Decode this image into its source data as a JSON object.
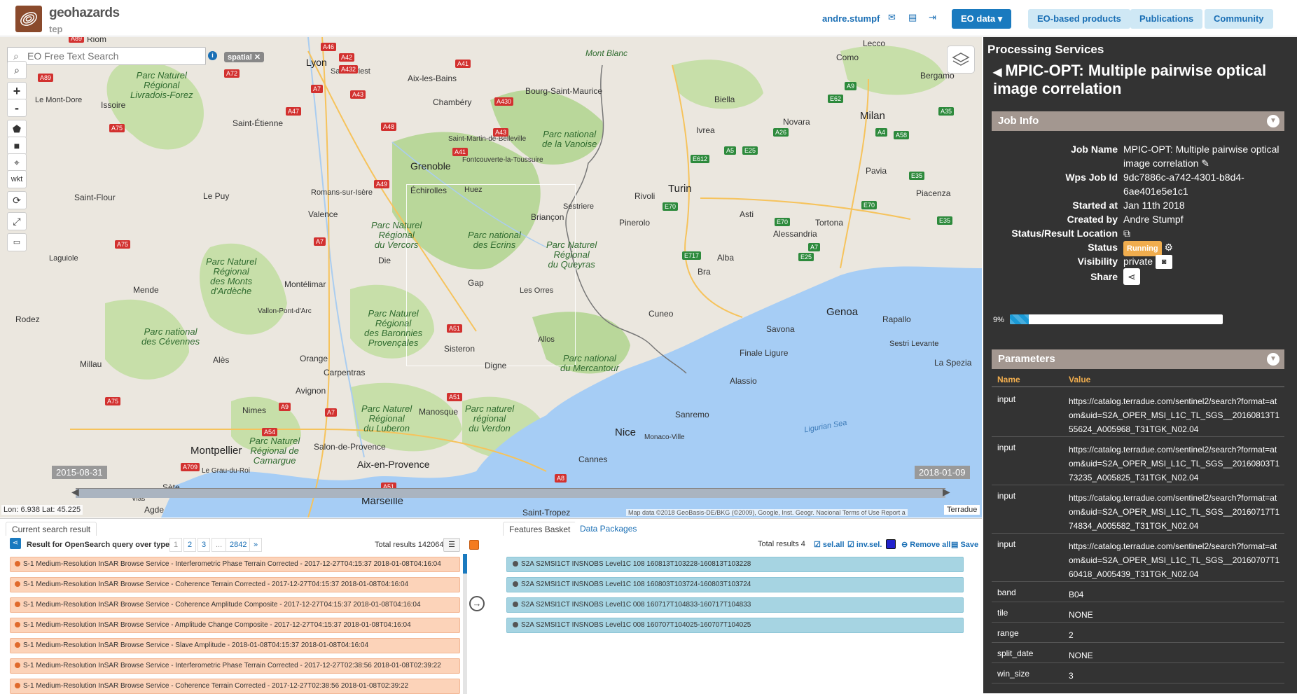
{
  "header": {
    "logo_name": "geohazards",
    "logo_sub": "tep",
    "username": "andre.stumpf",
    "nav": {
      "eo_data": "EO data ▾",
      "eo_products": "EO-based products",
      "publications": "Publications",
      "community": "Community"
    }
  },
  "map": {
    "search_placeholder": "EO Free Text Search",
    "spatial_tag": "spatial ✕",
    "wkt_label": "wkt",
    "date_start": "2015-08-31",
    "date_end": "2018-01-09",
    "coords": "Lon: 6.938 Lat: 45.225",
    "attribution": "Map data ©2018 GeoBasis-DE/BKG (©2009), Google, Inst. Geogr. Nacional   Terms of Use   Report a",
    "terradue": "Terradue",
    "labels": {
      "riom": "Riom",
      "lyon": "Lyon",
      "mont_blanc": "Mont Blanc",
      "lecco": "Lecco",
      "como": "Como",
      "issoire": "Issoire",
      "le_mont_dore": "Le Mont-Dore",
      "aix_les_bains": "Aix-les-Bains",
      "chambery": "Chambéry",
      "bourg": "Bourg-Saint-Maurice",
      "biella": "Biella",
      "bergamo": "Bergamo",
      "milan": "Milan",
      "novara": "Novara",
      "ivrea": "Ivrea",
      "st_etienne": "Saint-Étienne",
      "saint_priest": "Saint-Priest",
      "st_martin": "Saint-Martin-de-Belleville",
      "fontcouverte": "Fontcouverte-la-Toussuire",
      "grenoble": "Grenoble",
      "echirolles": "Échirolles",
      "huez": "Huez",
      "briancon": "Briançon",
      "sestriere": "Sestriere",
      "rivoli": "Rivoli",
      "turin": "Turin",
      "asti": "Asti",
      "pavia": "Pavia",
      "piacenza": "Piacenza",
      "le_puy": "Le Puy",
      "saint_flour": "Saint-Flour",
      "romans": "Romans-sur-Isère",
      "valence": "Valence",
      "pinerolo": "Pinerolo",
      "alessandria": "Alessandria",
      "tortona": "Tortona",
      "laguiole": "Laguiole",
      "die": "Die",
      "gap": "Gap",
      "les_orres": "Les Orres",
      "bra": "Bra",
      "alba": "Alba",
      "mende": "Mende",
      "montelimar": "Montélimar",
      "vallon": "Vallon-Pont-d'Arc",
      "cuneo": "Cuneo",
      "genoa": "Genoa",
      "rapallo": "Rapallo",
      "rodez": "Rodez",
      "savona": "Savona",
      "sestri": "Sestri Levante",
      "la_spezia": "La Spezia",
      "finale": "Finale Ligure",
      "sisteron": "Sisteron",
      "allos": "Allos",
      "millau": "Millau",
      "ales": "Alès",
      "orange": "Orange",
      "carpentras": "Carpentras",
      "digne": "Digne",
      "alassio": "Alassio",
      "avignon": "Avignon",
      "nimes": "Nimes",
      "manosque": "Manosque",
      "sanremo": "Sanremo",
      "nice": "Nice",
      "monaco": "Monaco-Ville",
      "montpellier": "Montpellier",
      "salon": "Salon-de-Provence",
      "aix": "Aix-en-Provence",
      "cannes": "Cannes",
      "le_grau": "Le Grau-du-Roi",
      "sete": "Sète",
      "marseille": "Marseille",
      "saint_tropez": "Saint-Tropez",
      "agde": "Agde",
      "vias": "Vias",
      "ligurian_sea": "Ligurian Sea",
      "park_livradois": "Parc Naturel\nRégional\nLivradois-Forez",
      "park_vanoise": "Parc national\nde la Vanoise",
      "park_vercors": "Parc Naturel\nRégional\ndu Vercors",
      "park_ecrins": "Parc national\ndes Ecrins",
      "park_queyras": "Parc Naturel\nRégional\ndu Queyras",
      "park_ardeche": "Parc Naturel\nRégional\ndes Monts\nd'Ardèche",
      "park_baronnies": "Parc Naturel\nRégional\ndes Baronnies\nProvençales",
      "park_cevennes": "Parc national\ndes Cévennes",
      "park_luberon": "Parc Naturel\nRégional\ndu Luberon",
      "park_verdon": "Parc naturel\nrégional\ndu Verdon",
      "park_mercantour": "Parc national\ndu Mercantour",
      "park_camargue": "Parc Naturel\nRégional de\nCamargue"
    }
  },
  "results": {
    "tab_current": "Current search result",
    "title": "Result for OpenSearch query over type ...",
    "pages": [
      "1",
      "2",
      "3",
      "...",
      "2842",
      "»"
    ],
    "total": "Total results  142064",
    "items": [
      "S-1 Medium-Resolution InSAR Browse Service - Interferometric Phase Terrain Corrected - 2017-12-27T04:15:37 2018-01-08T04:16:04",
      "S-1 Medium-Resolution InSAR Browse Service - Coherence Terrain Corrected - 2017-12-27T04:15:37 2018-01-08T04:16:04",
      "S-1 Medium-Resolution InSAR Browse Service - Coherence Amplitude Composite - 2017-12-27T04:15:37 2018-01-08T04:16:04",
      "S-1 Medium-Resolution InSAR Browse Service - Amplitude Change Composite - 2017-12-27T04:15:37 2018-01-08T04:16:04",
      "S-1 Medium-Resolution InSAR Browse Service - Slave Amplitude - 2018-01-08T04:15:37 2018-01-08T04:16:04",
      "S-1 Medium-Resolution InSAR Browse Service - Interferometric Phase Terrain Corrected - 2017-12-27T02:38:56 2018-01-08T02:39:22",
      "S-1 Medium-Resolution InSAR Browse Service - Coherence Terrain Corrected - 2017-12-27T02:38:56 2018-01-08T02:39:22"
    ]
  },
  "basket": {
    "tab_features": "Features Basket",
    "tab_packages": "Data Packages",
    "total": "Total results  4",
    "sel_all": "sel.all",
    "inv_sel": "inv.sel.",
    "remove_all": "Remove all",
    "save": "Save",
    "items": [
      "S2A S2MSI1CT INSNOBS Level1C 108 160813T103228-160813T103228",
      "S2A S2MSI1CT INSNOBS Level1C 108 160803T103724-160803T103724",
      "S2A S2MSI1CT INSNOBS Level1C 008 160717T104833-160717T104833",
      "S2A S2MSI1CT INSNOBS Level1C 008 160707T104025-160707T104025"
    ]
  },
  "panel": {
    "title": "Processing Services",
    "job_title": "MPIC-OPT: Multiple pairwise optical image correlation",
    "job_info_head": "Job Info",
    "fields": {
      "job_name_label": "Job Name",
      "job_name": "MPIC-OPT: Multiple pairwise optical image correlation ✎",
      "wps_label": "Wps Job Id",
      "wps_id": "9dc7886c-a742-4301-b8d4-6ae401e5e1c1",
      "started_label": "Started at",
      "started": "Jan 11th 2018",
      "created_label": "Created by",
      "created": "Andre Stumpf",
      "location_label": "Status/Result Location",
      "status_label": "Status",
      "status": "Running",
      "visibility_label": "Visibility",
      "visibility": "private",
      "share_label": "Share"
    },
    "progress_label": "9%",
    "progress": 0.09,
    "params_head": "Parameters",
    "params_col_name": "Name",
    "params_col_value": "Value",
    "params": [
      {
        "name": "input",
        "value": "https://catalog.terradue.com/sentinel2/search?format=atom&uid=S2A_OPER_MSI_L1C_TL_SGS__20160813T155624_A005968_T31TGK_N02.04"
      },
      {
        "name": "input",
        "value": "https://catalog.terradue.com/sentinel2/search?format=atom&uid=S2A_OPER_MSI_L1C_TL_SGS__20160803T173235_A005825_T31TGK_N02.04"
      },
      {
        "name": "input",
        "value": "https://catalog.terradue.com/sentinel2/search?format=atom&uid=S2A_OPER_MSI_L1C_TL_SGS__20160717T174834_A005582_T31TGK_N02.04"
      },
      {
        "name": "input",
        "value": "https://catalog.terradue.com/sentinel2/search?format=atom&uid=S2A_OPER_MSI_L1C_TL_SGS__20160707T160418_A005439_T31TGK_N02.04"
      },
      {
        "name": "band",
        "value": "B04"
      },
      {
        "name": "tile",
        "value": "NONE"
      },
      {
        "name": "range",
        "value": "2"
      },
      {
        "name": "split_date",
        "value": "NONE"
      },
      {
        "name": "win_size",
        "value": "3"
      }
    ]
  }
}
